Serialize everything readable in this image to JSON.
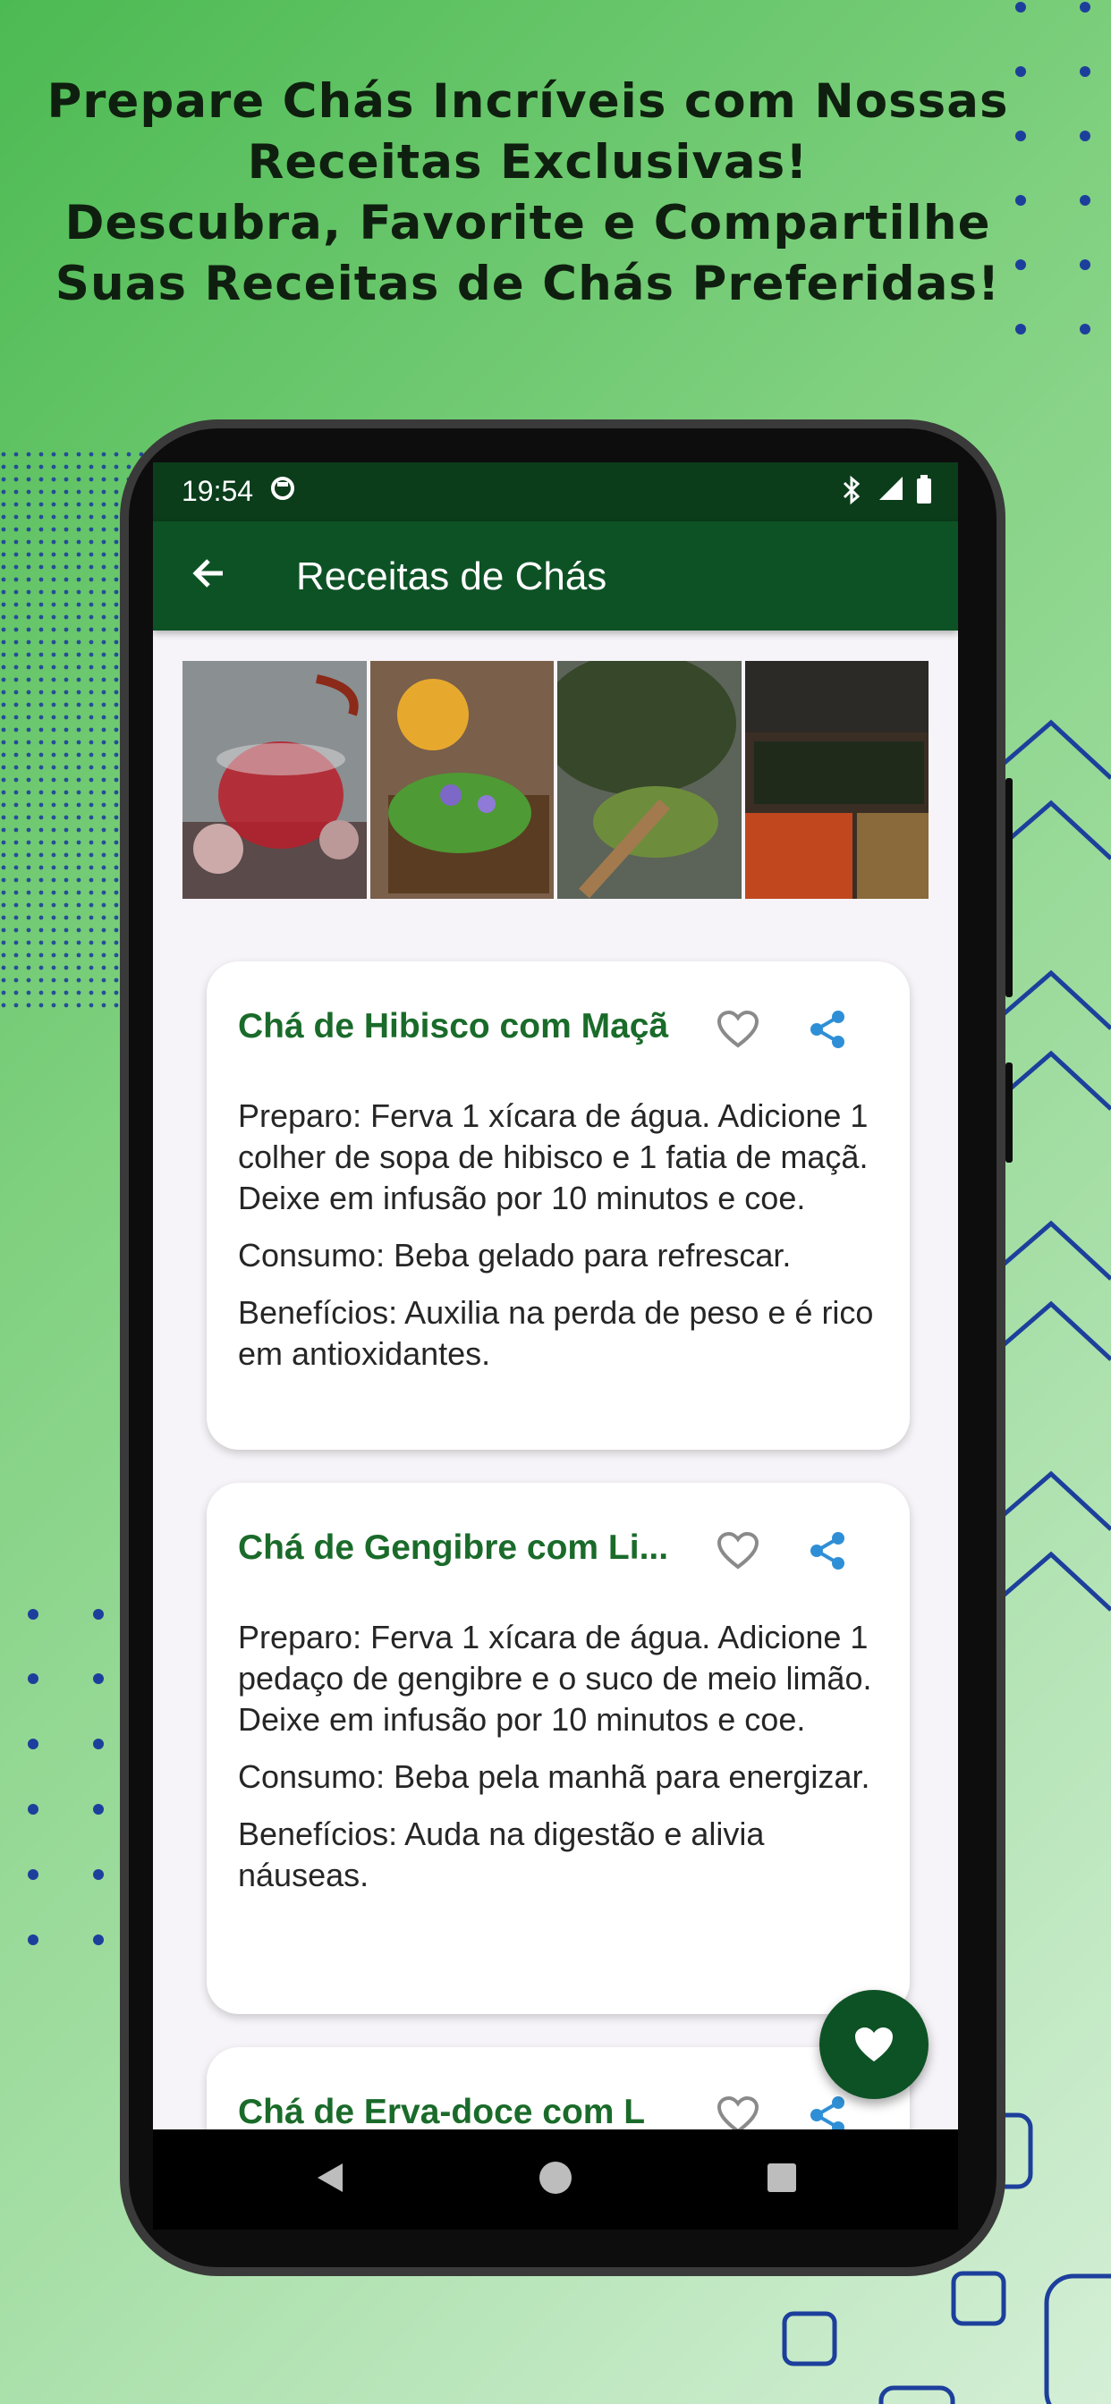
{
  "promo": {
    "line1": "Prepare Chás Incríveis com Nossas",
    "line2": "Receitas Exclusivas!",
    "line3": "Descubra, Favorite e Compartilhe",
    "line4": "Suas Receitas de Chás Preferidas!"
  },
  "status_bar": {
    "time": "19:54"
  },
  "app_bar": {
    "title": "Receitas de Chás"
  },
  "colors": {
    "primary": "#0d5225",
    "status_bar": "#0b3d1b",
    "card_title": "#1a6b2a",
    "share": "#2f8fd6"
  },
  "recipes": [
    {
      "title": "Chá de Hibisco com Maçã",
      "preparo": "Preparo: Ferva 1 xícara de água. Adicione 1 colher de sopa de hibisco e 1 fatia de maçã. Deixe em infusão por 10 minutos e coe.",
      "consumo": "Consumo: Beba gelado para refrescar.",
      "beneficios": "Benefícios: Auxilia na perda de peso e é rico em antioxidantes."
    },
    {
      "title": "Chá de Gengibre com Li...",
      "preparo": "Preparo: Ferva 1 xícara de água. Adicione 1 pedaço de gengibre e o suco de meio limão. Deixe em infusão por 10 minutos e coe.",
      "consumo": "Consumo: Beba pela manhã para energizar.",
      "beneficios": "Benefícios: Auda na digestão e alivia náuseas."
    },
    {
      "title": "Chá de Erva-doce com L"
    }
  ],
  "icons": {
    "back": "arrow-left-icon",
    "favorite": "heart-outline-icon",
    "share": "share-icon",
    "fab": "heart-filled-icon",
    "nav_back": "triangle-back-icon",
    "nav_home": "circle-home-icon",
    "nav_recents": "square-recents-icon"
  }
}
